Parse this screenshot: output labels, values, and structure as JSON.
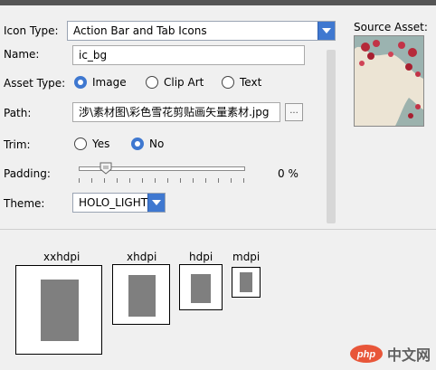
{
  "form": {
    "icon_type": {
      "label": "Icon Type:",
      "value": "Action Bar and Tab Icons"
    },
    "name": {
      "label": "Name:",
      "value": "ic_bg"
    },
    "asset_type": {
      "label": "Asset Type:",
      "options": [
        "Image",
        "Clip Art",
        "Text"
      ],
      "selected": "Image"
    },
    "path": {
      "label": "Path:",
      "value": "涉\\素材图\\彩色雪花剪贴画矢量素材.jpg",
      "browse_label": "..."
    },
    "trim": {
      "label": "Trim:",
      "options": [
        "Yes",
        "No"
      ],
      "selected": "No"
    },
    "padding": {
      "label": "Padding:",
      "value": 0,
      "value_text": "0 %"
    },
    "theme": {
      "label": "Theme:",
      "value": "HOLO_LIGHT"
    }
  },
  "source_asset": {
    "label": "Source Asset:"
  },
  "previews": [
    {
      "label": "xxhdpi"
    },
    {
      "label": "xhdpi"
    },
    {
      "label": "hdpi"
    },
    {
      "label": "mdpi"
    }
  ],
  "watermark": {
    "text": "中文网",
    "logo_text": "php"
  },
  "colors": {
    "accent": "#3f78d0",
    "preview_fill": "#7f7f7f"
  }
}
